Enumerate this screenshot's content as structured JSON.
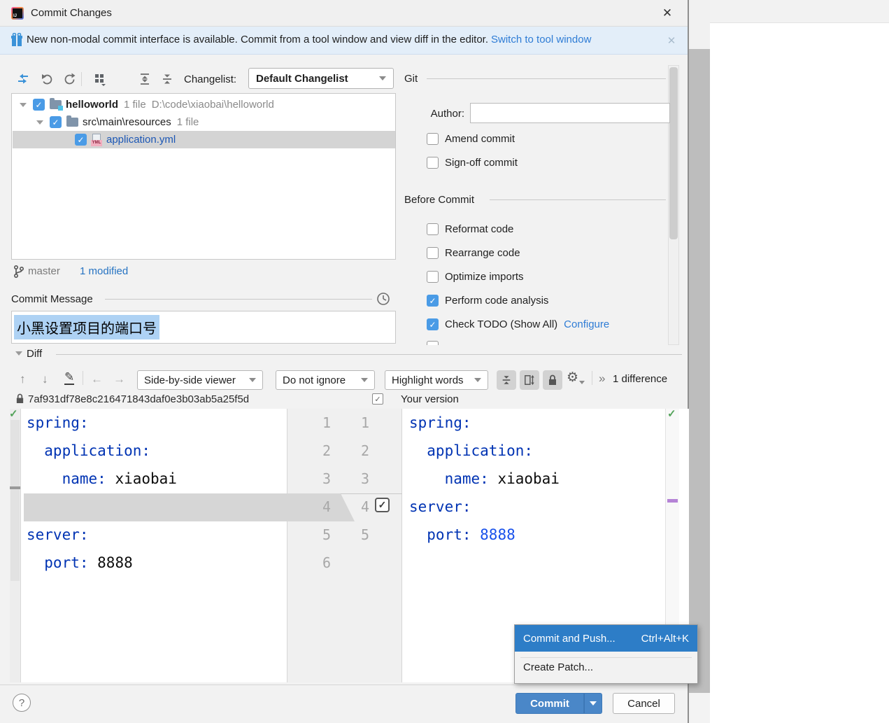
{
  "window": {
    "title": "Commit Changes",
    "close_glyph": "✕"
  },
  "banner": {
    "message": "New non-modal commit interface is available. Commit from a tool window and view diff in the editor.",
    "action": "Switch to tool window",
    "close_glyph": "✕"
  },
  "changelist": {
    "label": "Changelist:",
    "value": "Default Changelist"
  },
  "tree": {
    "root": {
      "name": "helloworld",
      "count": "1 file",
      "path": "D:\\code\\xiaobai\\helloworld"
    },
    "dir": {
      "name": "src\\main\\resources",
      "count": "1 file"
    },
    "file": {
      "name": "application.yml",
      "type_badge": "YML"
    }
  },
  "branch": {
    "name": "master",
    "modified": "1 modified"
  },
  "commit_message": {
    "label": "Commit Message",
    "text": "小黑设置项目的端口号"
  },
  "git_panel": {
    "title": "Git",
    "author_label": "Author:",
    "author_value": "",
    "amend": "Amend commit",
    "signoff": "Sign-off commit"
  },
  "before_commit": {
    "title": "Before Commit",
    "options": [
      {
        "label": "Reformat code",
        "checked": false
      },
      {
        "label": "Rearrange code",
        "checked": false
      },
      {
        "label": "Optimize imports",
        "checked": false
      },
      {
        "label": "Perform code analysis",
        "checked": true
      },
      {
        "label": "Check TODO (Show All)",
        "checked": true,
        "link": "Configure"
      }
    ]
  },
  "diff": {
    "section_label": "Diff",
    "viewer": "Side-by-side viewer",
    "ignore_policy": "Do not ignore",
    "highlight_policy": "Highlight words",
    "differences": "1 difference",
    "revision": "7af931df78e8c216471843daf0e3b03ab5a25f5d",
    "your_version": "Your version",
    "left": {
      "numbers": [
        "1",
        "2",
        "3",
        "4",
        "5",
        "6"
      ],
      "lines": [
        {
          "key": "spring:",
          "value": ""
        },
        {
          "key": "  application:",
          "value": ""
        },
        {
          "key": "    name:",
          "value": " xiaobai"
        },
        {
          "key": "",
          "value": ""
        },
        {
          "key": "server:",
          "value": ""
        },
        {
          "key": "  port:",
          "value": " 8888"
        }
      ]
    },
    "right": {
      "numbers": [
        "1",
        "2",
        "3",
        "4",
        "5"
      ],
      "lines": [
        {
          "key": "spring:",
          "value": ""
        },
        {
          "key": "  application:",
          "value": ""
        },
        {
          "key": "    name:",
          "value": " xiaobai"
        },
        {
          "key": "server:",
          "value": ""
        },
        {
          "key": "  port:",
          "value": " 8888"
        }
      ]
    }
  },
  "popup": {
    "items": [
      {
        "label": "Commit and Push...",
        "shortcut": "Ctrl+Alt+K"
      },
      {
        "label": "Create Patch...",
        "shortcut": ""
      }
    ]
  },
  "footer": {
    "help": "?",
    "commit": "Commit",
    "cancel": "Cancel"
  },
  "icons": {
    "check": "✓",
    "up": "↑",
    "down": "↓",
    "left": "←",
    "right": "→",
    "pencil": "✎",
    "gear": "⚙",
    "chevrons": "»"
  },
  "colors": {
    "checkbox_accent": "#4a9be6",
    "commit_button": "#4a87c8",
    "popup_selection": "#2d7dc7",
    "link": "#2e7cd5",
    "yaml_key": "#0033b3",
    "yaml_number": "#1750eb",
    "banner_bg": "#e3eef9"
  }
}
